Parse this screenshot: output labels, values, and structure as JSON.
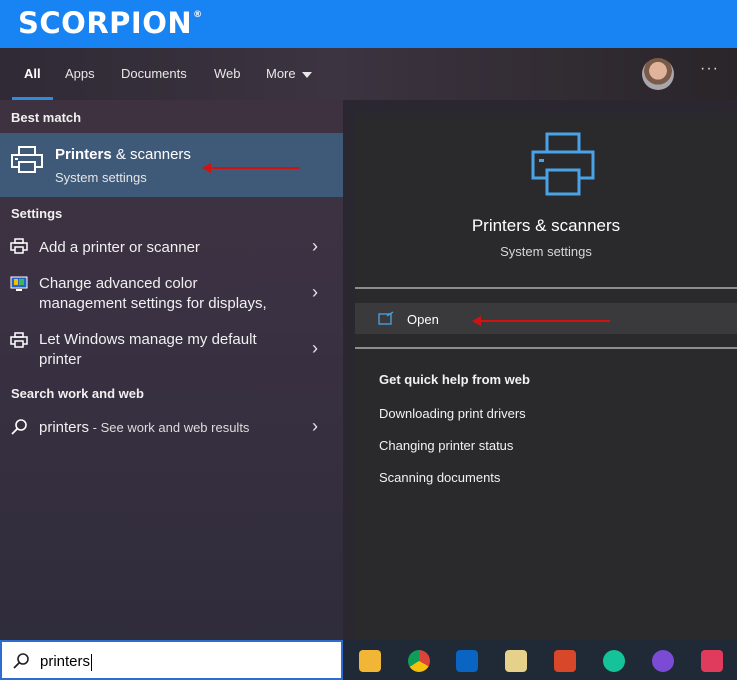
{
  "brand": {
    "logo_text": "SCORPION",
    "logo_mark": "®"
  },
  "nav": {
    "tabs": [
      {
        "label": "All",
        "active": true
      },
      {
        "label": "Apps"
      },
      {
        "label": "Documents"
      },
      {
        "label": "Web"
      },
      {
        "label": "More"
      }
    ],
    "more_icon": "ellipsis-icon"
  },
  "results": {
    "best_match_header": "Best match",
    "best_match": {
      "title_strong": "Printers",
      "title_rest": " & scanners",
      "subtitle": "System settings",
      "icon": "printer-icon"
    },
    "settings_header": "Settings",
    "settings": [
      {
        "label": "Add a printer or scanner",
        "icon": "printer-icon"
      },
      {
        "label_line1": "Change advanced color",
        "label_line2": "management settings for displays,",
        "icon": "display-color-icon"
      },
      {
        "label_line1": "Let Windows manage my default",
        "label_line2": "printer",
        "icon": "printer-icon"
      }
    ],
    "web_header": "Search work and web",
    "web_item": {
      "query": "printers",
      "suffix": " - See work and web results",
      "icon": "search-icon"
    }
  },
  "preview": {
    "title": "Printers & scanners",
    "subtitle": "System settings",
    "open_label": "Open",
    "quick_help_header": "Get quick help from web",
    "help_links": [
      "Downloading print drivers",
      "Changing printer status",
      "Scanning documents"
    ]
  },
  "search": {
    "value": "printers"
  },
  "taskbar": {
    "apps": [
      "file-explorer-icon",
      "chrome-icon",
      "outlook-icon",
      "notepad-icon",
      "snipping-tool-icon",
      "grammarly-icon",
      "picsart-icon",
      "creative-cloud-icon"
    ]
  },
  "colors": {
    "accent": "#2d8be0",
    "banner": "#1883f2",
    "annotation_arrow": "#d01212",
    "selected_row": "#3f5a78"
  }
}
